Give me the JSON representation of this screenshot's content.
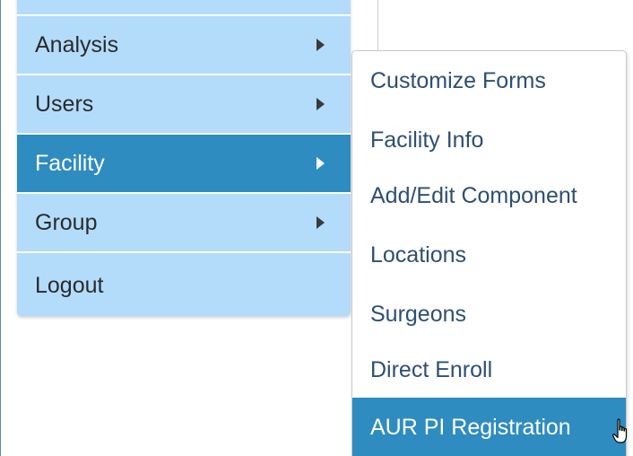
{
  "main_menu": {
    "items": [
      {
        "label": "",
        "has_arrow": false
      },
      {
        "label": "Analysis",
        "has_arrow": true
      },
      {
        "label": "Users",
        "has_arrow": true
      },
      {
        "label": "Facility",
        "has_arrow": true,
        "active": true
      },
      {
        "label": "Group",
        "has_arrow": true
      },
      {
        "label": "Logout",
        "has_arrow": false
      }
    ]
  },
  "sub_menu": {
    "items": [
      {
        "label": "Customize Forms"
      },
      {
        "label": "Facility Info"
      },
      {
        "label": "Add/Edit Component"
      },
      {
        "label": "Locations"
      },
      {
        "label": "Surgeons"
      },
      {
        "label": "Direct Enroll"
      },
      {
        "label": "AUR PI Registration",
        "active": true
      }
    ]
  },
  "colors": {
    "menu_bg": "#b3dcfa",
    "active_bg": "#2e8cc0",
    "submenu_text": "#2d4f73"
  },
  "cursor": "hand-pointer-icon"
}
